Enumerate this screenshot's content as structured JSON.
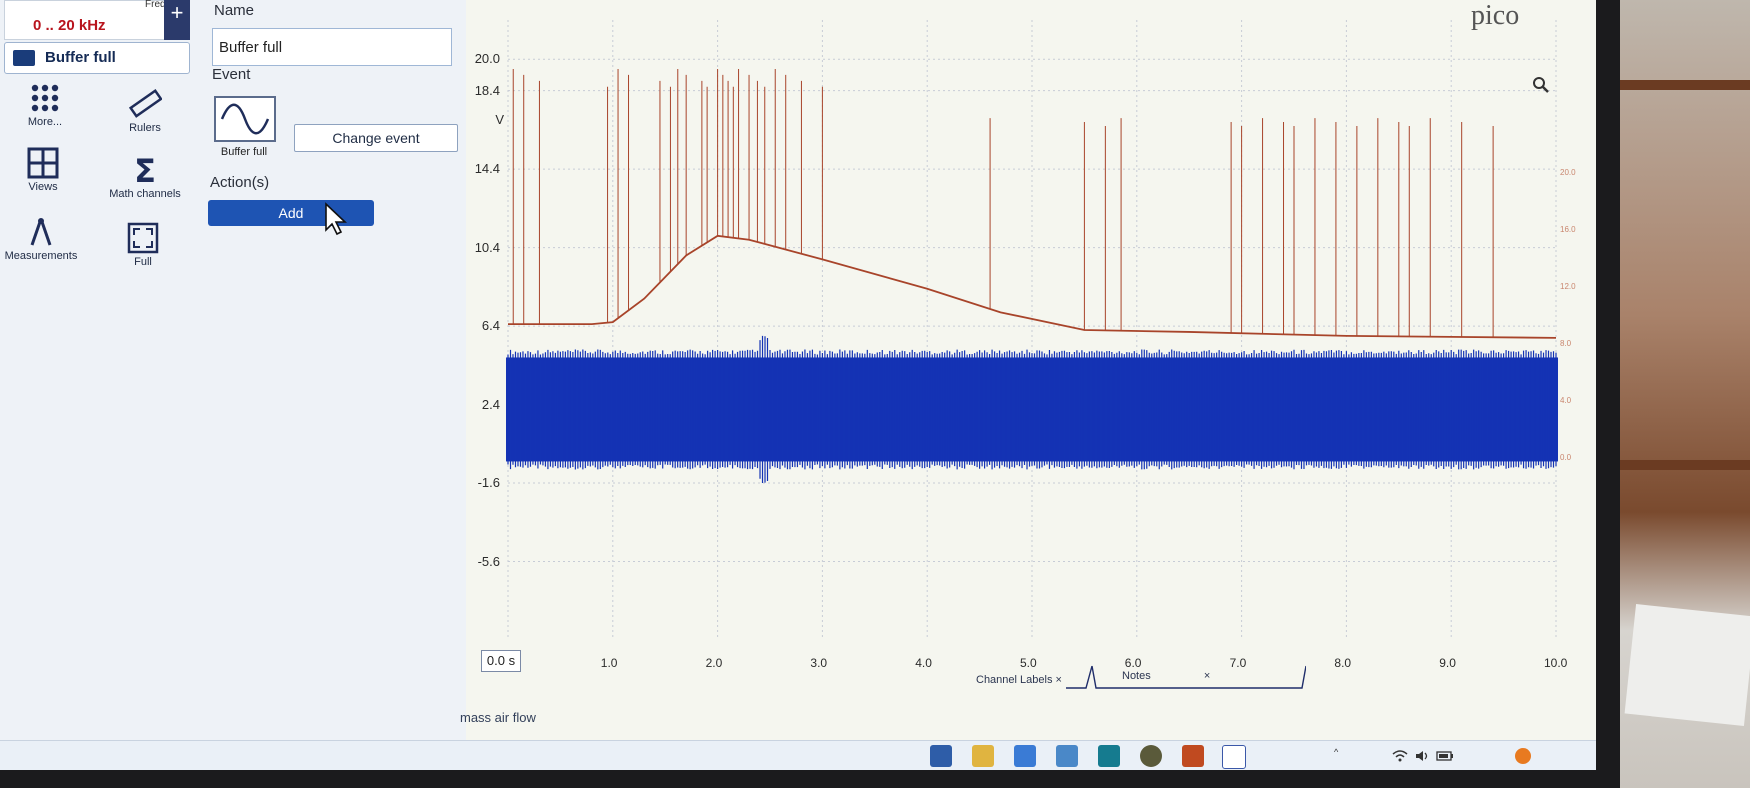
{
  "left_panel": {
    "freq_label": "Freq",
    "freq_value": "0 .. 20 kHz",
    "plus_label": "+",
    "buffer_label": "Buffer full",
    "tools": [
      {
        "label": "More...",
        "icon": "more-dots-icon"
      },
      {
        "label": "Rulers",
        "icon": "ruler-icon"
      },
      {
        "label": "Views",
        "icon": "views-grid-icon"
      },
      {
        "label": "Math channels",
        "icon": "sigma-icon"
      },
      {
        "label": "Measurements",
        "icon": "caliper-icon"
      },
      {
        "label": "Full",
        "icon": "fullscreen-icon"
      }
    ]
  },
  "properties": {
    "name_heading": "Name",
    "name_value": "Buffer full",
    "event_heading": "Event",
    "event_caption": "Buffer full",
    "change_event_label": "Change event",
    "actions_heading": "Action(s)",
    "add_label": "Add"
  },
  "plot": {
    "brand": "pico",
    "unit_label": "V",
    "y_ticks": [
      "20.0",
      "18.4",
      "14.4",
      "10.4",
      "6.4",
      "2.4",
      "-1.6",
      "-5.6"
    ],
    "x_ticks": [
      "1.0",
      "2.0",
      "3.0",
      "4.0",
      "5.0",
      "6.0",
      "7.0",
      "8.0",
      "9.0",
      "10.0"
    ],
    "right_ticks": [
      "20.0",
      "16.0",
      "12.0",
      "8.0",
      "4.0",
      "0.0"
    ],
    "start_value": "0.0 s",
    "tabs": [
      {
        "label": "Channel Labels"
      },
      {
        "label": "Notes"
      }
    ],
    "trace_label": "mass air flow",
    "colors": {
      "channel_a": "#1433b4",
      "channel_b": "#a8442a"
    }
  },
  "chart_data": {
    "type": "line",
    "title": "",
    "xlabel": "",
    "ylabel": "V",
    "xlim": [
      0,
      10
    ],
    "ylim": [
      -9.6,
      22
    ],
    "grid": true,
    "series": [
      {
        "name": "",
        "x": [
          0,
          0.8,
          1.0,
          1.3,
          1.7,
          2.0,
          2.3,
          3.0,
          4.0,
          4.7,
          5.5,
          6.5,
          8.0,
          9.0,
          10.0
        ],
        "y": [
          6.5,
          6.5,
          6.6,
          7.8,
          10.0,
          11.0,
          10.8,
          9.8,
          8.3,
          7.1,
          6.2,
          6.1,
          5.9,
          5.85,
          5.8
        ]
      },
      {
        "name": "",
        "x": [
          0,
          10
        ],
        "y_band": [
          -0.5,
          4.8
        ]
      }
    ],
    "spike_times": [
      0.05,
      0.15,
      0.3,
      0.95,
      1.05,
      1.15,
      1.45,
      1.55,
      1.62,
      1.7,
      1.85,
      1.9,
      2.0,
      2.05,
      2.1,
      2.15,
      2.2,
      2.3,
      2.38,
      2.45,
      2.55,
      2.65,
      2.8,
      3.0,
      4.6,
      5.5,
      5.7,
      5.85,
      6.9,
      7.0,
      7.2,
      7.4,
      7.5,
      7.7,
      7.9,
      8.1,
      8.3,
      8.5,
      8.6,
      8.8,
      9.1,
      9.4
    ],
    "spike_top": 19.5
  }
}
